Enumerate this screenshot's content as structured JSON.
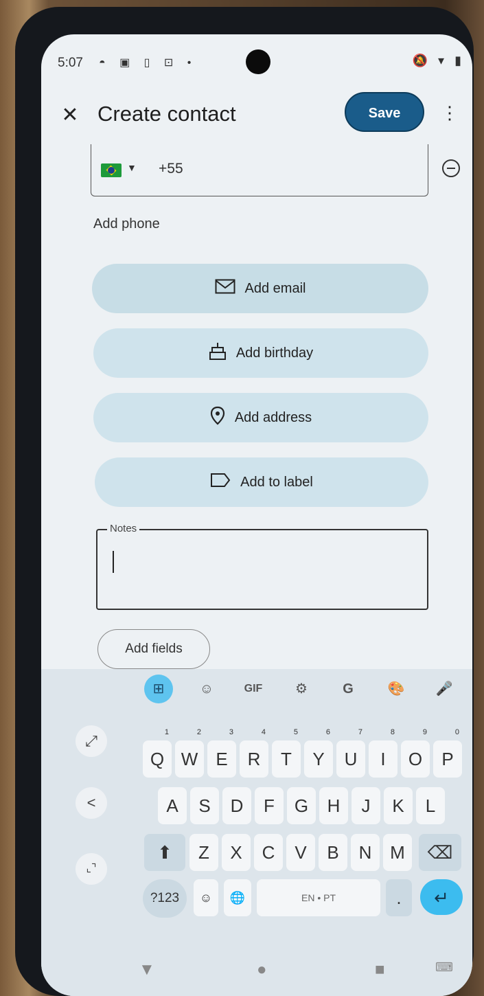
{
  "status_bar": {
    "time": "5:07",
    "icons": "◓ ▣ ▯ ⊡ •",
    "right": [
      "🔕",
      "▾",
      "▮"
    ]
  },
  "header": {
    "title": "Create contact",
    "save_label": "Save",
    "close_icon": "✕",
    "more_icon": "⋮"
  },
  "phone": {
    "country_code": "+55"
  },
  "add_phone_label": "Add phone",
  "actions": [
    {
      "label": "Add email",
      "icon": "✉"
    },
    {
      "label": "Add birthday",
      "icon": "🎂"
    },
    {
      "label": "Add address",
      "icon": "📍"
    },
    {
      "label": "Add to label",
      "icon": "⬠"
    }
  ],
  "notes": {
    "label": "Notes"
  },
  "add_fields_label": "Add fields",
  "keyboard": {
    "toolbar": [
      "⊞",
      "☺",
      "GIF",
      "⚙",
      "G",
      "🎨",
      "🎤"
    ],
    "row1": [
      "Q",
      "W",
      "E",
      "R",
      "T",
      "Y",
      "U",
      "I",
      "O",
      "P"
    ],
    "row1_nums": [
      "1",
      "2",
      "3",
      "4",
      "5",
      "6",
      "7",
      "8",
      "9",
      "0"
    ],
    "row2": [
      "A",
      "S",
      "D",
      "F",
      "G",
      "H",
      "J",
      "K",
      "L"
    ],
    "row3": [
      "Z",
      "X",
      "C",
      "V",
      "B",
      "N",
      "M"
    ],
    "shift": "⬆",
    "backspace": "⌫",
    "symbols": "?123",
    "emoji": "☺",
    "globe": "🌐",
    "space": "EN • PT",
    "period": ".",
    "enter": "↵",
    "side_expand": "⤢",
    "side_back": "<",
    "side_float": "⌞⌝"
  },
  "nav": {
    "back": "▼",
    "home": "●",
    "recents": "■",
    "keyboard": "⌨"
  }
}
